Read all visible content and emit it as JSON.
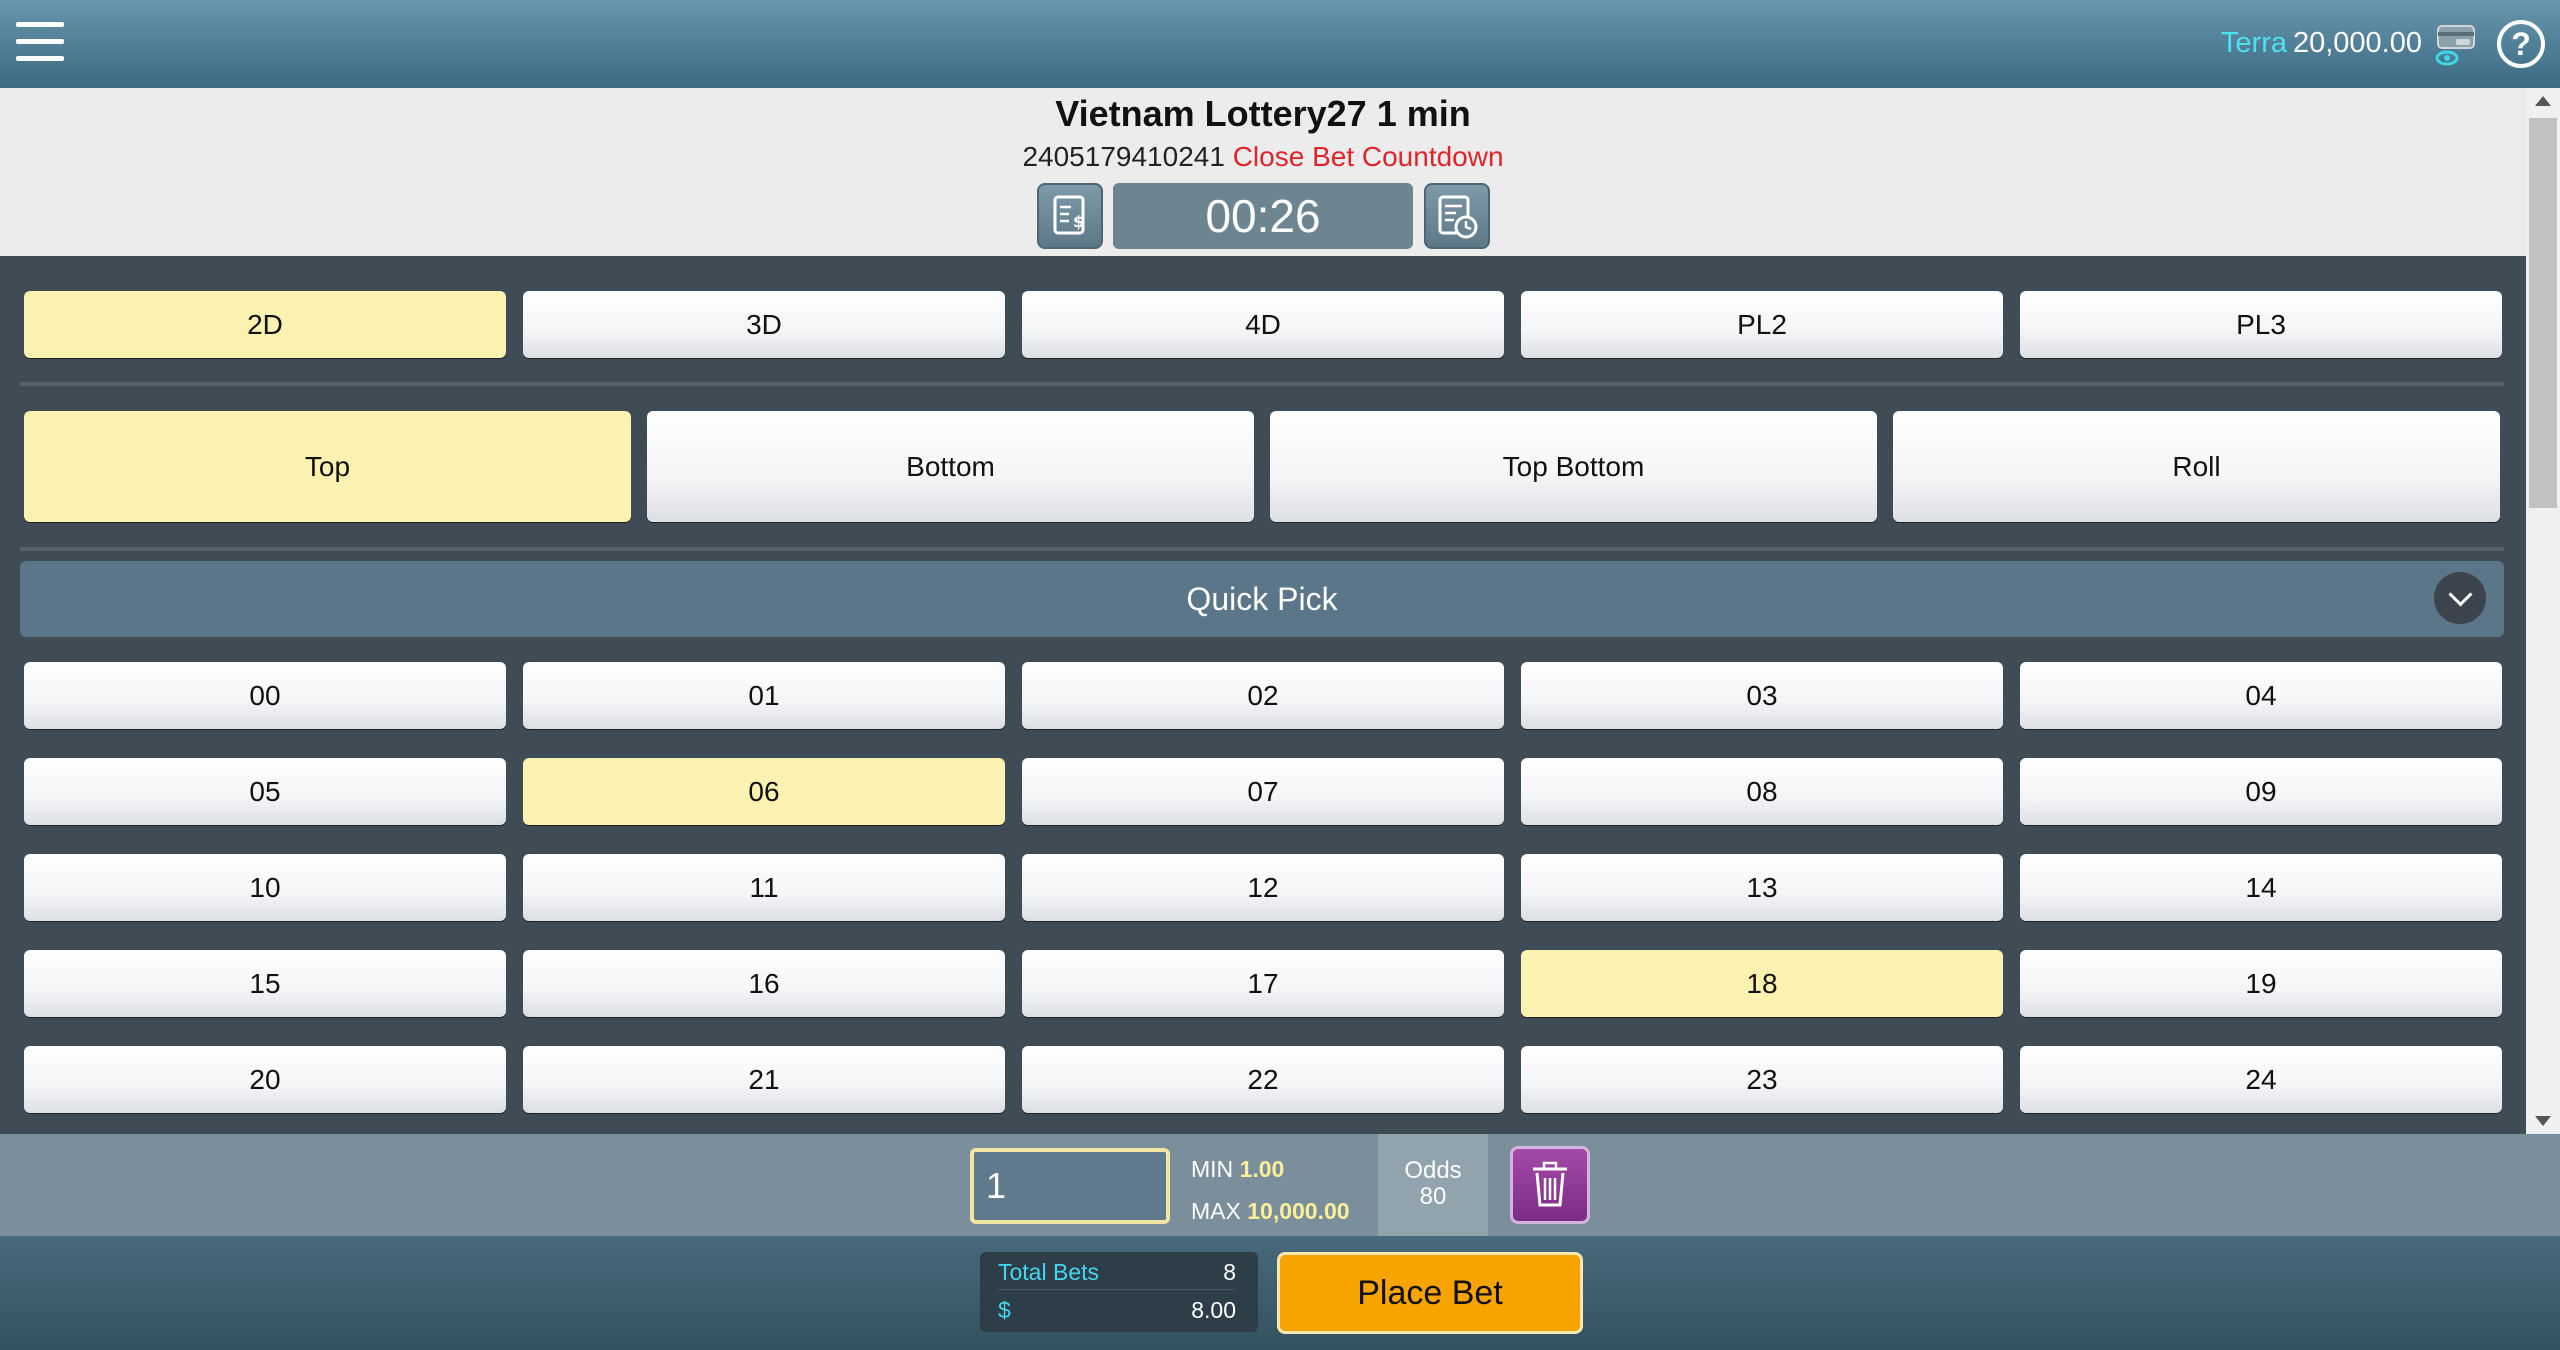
{
  "topbar": {
    "username": "Terra",
    "balance": "20,000.00",
    "help_glyph": "?"
  },
  "header": {
    "title": "Vietnam Lottery27 1 min",
    "round_id": "2405179410241",
    "countdown_label": "Close Bet Countdown",
    "timer": "00:26"
  },
  "game_types": [
    {
      "label": "2D",
      "selected": true
    },
    {
      "label": "3D",
      "selected": false
    },
    {
      "label": "4D",
      "selected": false
    },
    {
      "label": "PL2",
      "selected": false
    },
    {
      "label": "PL3",
      "selected": false
    }
  ],
  "bet_positions": [
    {
      "label": "Top",
      "selected": true
    },
    {
      "label": "Bottom",
      "selected": false
    },
    {
      "label": "Top Bottom",
      "selected": false
    },
    {
      "label": "Roll",
      "selected": false
    }
  ],
  "quick_pick": {
    "label": "Quick Pick"
  },
  "numbers": [
    {
      "label": "00",
      "selected": false
    },
    {
      "label": "01",
      "selected": false
    },
    {
      "label": "02",
      "selected": false
    },
    {
      "label": "03",
      "selected": false
    },
    {
      "label": "04",
      "selected": false
    },
    {
      "label": "05",
      "selected": false
    },
    {
      "label": "06",
      "selected": true
    },
    {
      "label": "07",
      "selected": false
    },
    {
      "label": "08",
      "selected": false
    },
    {
      "label": "09",
      "selected": false
    },
    {
      "label": "10",
      "selected": false
    },
    {
      "label": "11",
      "selected": false
    },
    {
      "label": "12",
      "selected": false
    },
    {
      "label": "13",
      "selected": false
    },
    {
      "label": "14",
      "selected": false
    },
    {
      "label": "15",
      "selected": false
    },
    {
      "label": "16",
      "selected": false
    },
    {
      "label": "17",
      "selected": false
    },
    {
      "label": "18",
      "selected": true
    },
    {
      "label": "19",
      "selected": false
    },
    {
      "label": "20",
      "selected": false
    },
    {
      "label": "21",
      "selected": false
    },
    {
      "label": "22",
      "selected": false
    },
    {
      "label": "23",
      "selected": false
    },
    {
      "label": "24",
      "selected": false
    }
  ],
  "bet": {
    "amount": "1",
    "min_label": "MIN",
    "min_value": "1.00",
    "max_label": "MAX",
    "max_value": "10,000.00",
    "odds_label": "Odds",
    "odds_value": "80"
  },
  "footer": {
    "total_bets_label": "Total Bets",
    "total_bets_value": "8",
    "currency_label": "$",
    "total_amount": "8.00",
    "place_bet_label": "Place Bet"
  },
  "colors": {
    "selected": "#fbf1b0",
    "accent_cyan": "#4fe0f0",
    "countdown_red": "#e0242c",
    "place_bet": "#f7a400",
    "trash": "#8d3a96"
  }
}
